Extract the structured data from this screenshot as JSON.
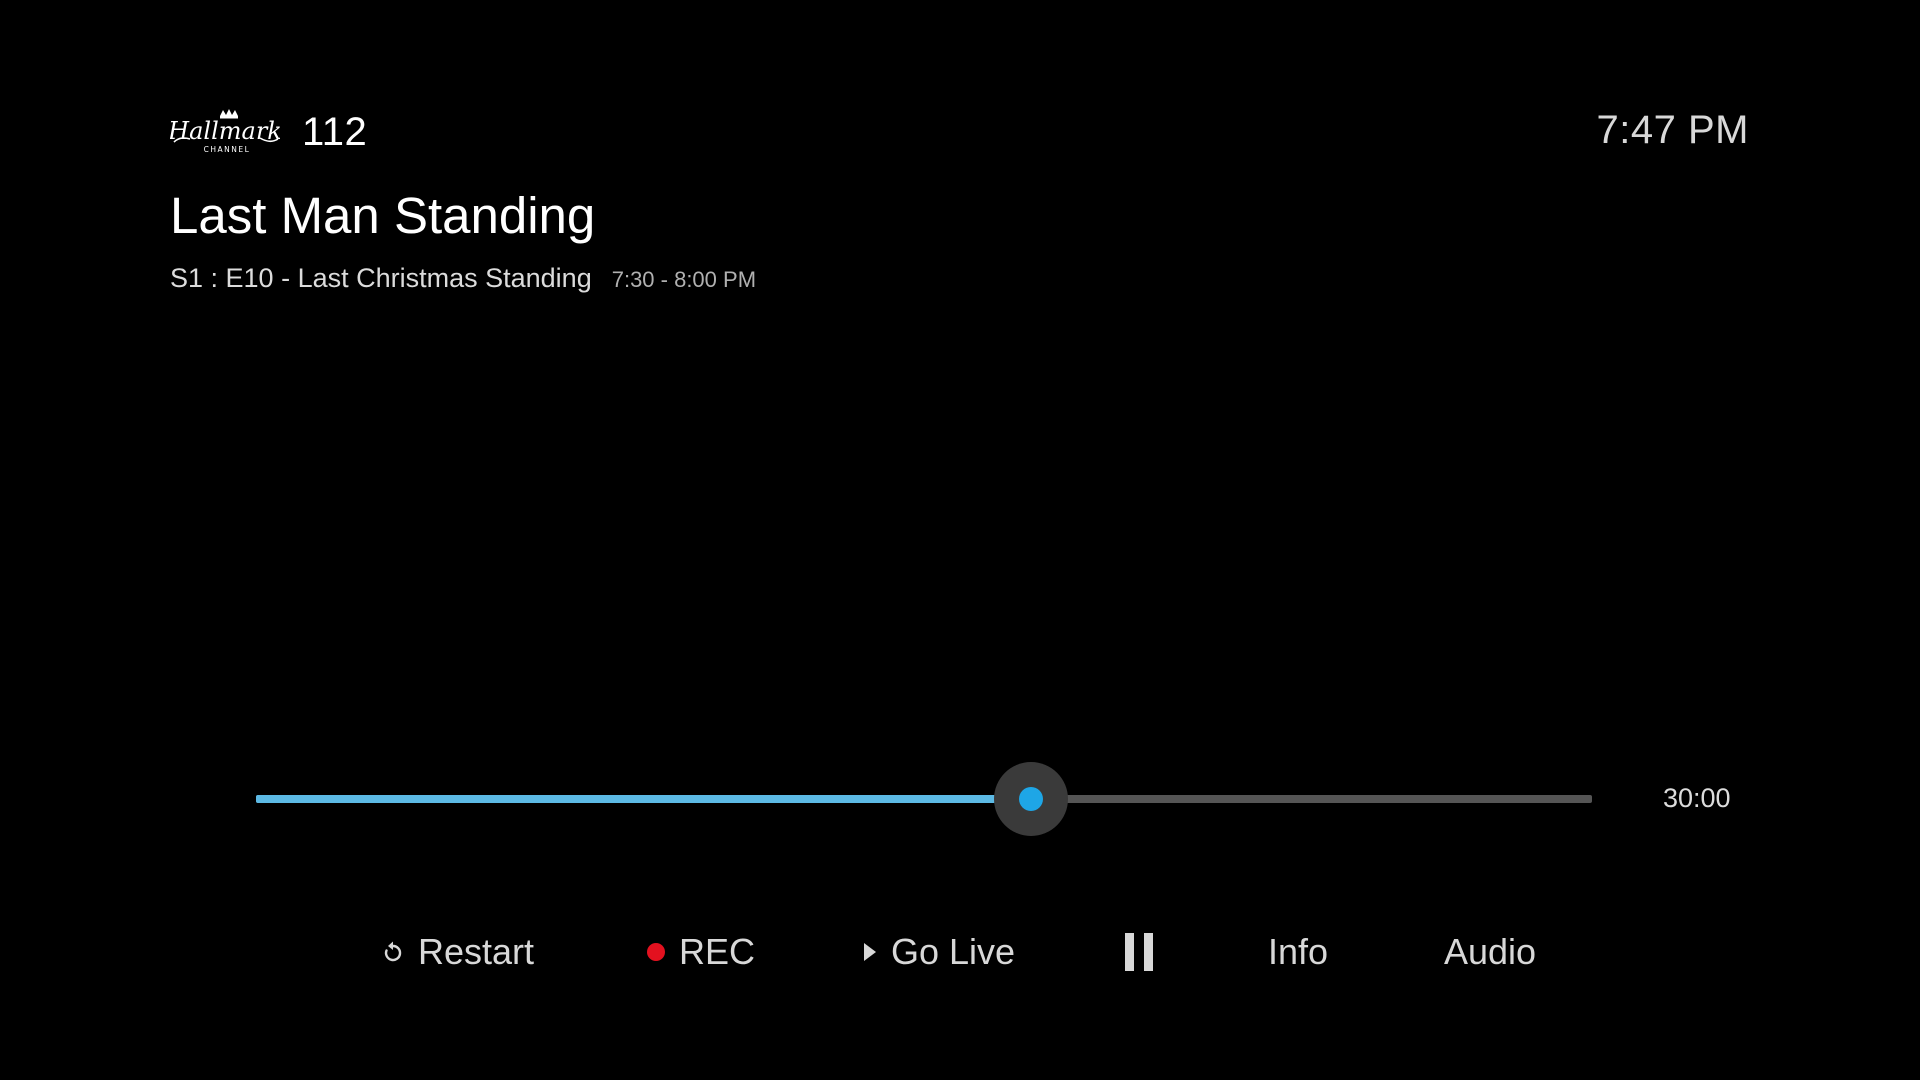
{
  "channel": {
    "logo_text": "Hallmark",
    "logo_subtext": "CHANNEL",
    "number": "112"
  },
  "clock": "7:47 PM",
  "program": {
    "title": "Last Man Standing",
    "episode": "S1 : E10 - Last Christmas Standing",
    "time_range": "7:30 - 8:00 PM"
  },
  "progress": {
    "fraction": 0.58,
    "duration": "30:00",
    "colors": {
      "fill": "#5cb9e4",
      "thumb": "#1ea6e6",
      "track": "#555555"
    }
  },
  "controls": {
    "restart": {
      "label": "Restart",
      "icon": "restart-icon"
    },
    "rec": {
      "label": "REC",
      "icon": "record-dot-icon",
      "color": "#e3111f"
    },
    "go_live": {
      "label": "Go Live",
      "icon": "play-triangle-icon"
    },
    "pause": {
      "icon": "pause-icon"
    },
    "info": {
      "label": "Info"
    },
    "audio": {
      "label": "Audio"
    }
  }
}
